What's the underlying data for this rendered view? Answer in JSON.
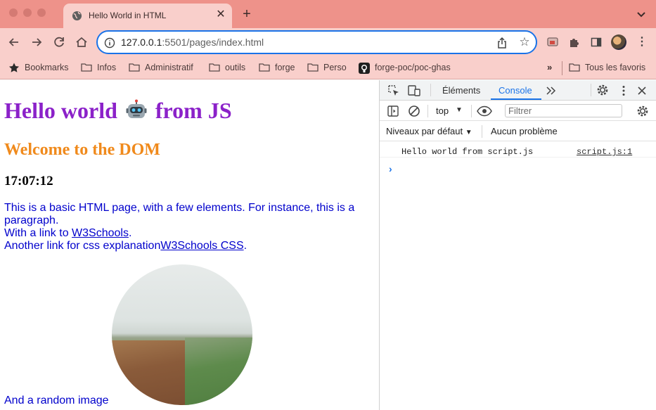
{
  "browser": {
    "tab": {
      "title": "Hello World in HTML",
      "favicon": "globe-icon"
    },
    "address": {
      "host": "127.0.0.1",
      "rest": ":5501/pages/index.html"
    },
    "bookmarks": [
      {
        "label": "Bookmarks",
        "icon": "star-icon"
      },
      {
        "label": "Infos",
        "icon": "folder-icon"
      },
      {
        "label": "Administratif",
        "icon": "folder-icon"
      },
      {
        "label": "outils",
        "icon": "folder-icon"
      },
      {
        "label": "forge",
        "icon": "folder-icon"
      },
      {
        "label": "Perso",
        "icon": "folder-icon"
      },
      {
        "label": "forge-poc/poc-ghas",
        "icon": "github-icon"
      }
    ],
    "bookmarks_overflow": "»",
    "all_bookmarks": "Tous les favoris",
    "colors": {
      "tabstrip": "#ee928a",
      "toolbar": "#f9cfcb",
      "accent": "#1a73e8"
    }
  },
  "page": {
    "heading_before": "Hello world",
    "heading_after": "from JS",
    "heading_icon": "robot-icon",
    "subheading": "Welcome to the DOM",
    "clock": "17:07:12",
    "para_line1": "This is a basic HTML page, with a few elements. For instance, this is a paragraph.",
    "para_line2_prefix": "With a link to ",
    "link1": "W3Schools",
    "para_line2_suffix": ".",
    "para_line3_prefix": "Another link for css explanation",
    "link2": "W3Schools CSS",
    "para_line3_suffix": ".",
    "image_caption": "And a random image",
    "colors": {
      "heading": "#8b21c9",
      "subheading": "#f08a1c",
      "text": "#0000cc"
    }
  },
  "devtools": {
    "tabs": [
      "Éléments",
      "Console"
    ],
    "active_tab": "Console",
    "context": "top",
    "filter_placeholder": "Filtrer",
    "levels": "Niveaux par défaut",
    "issues": "Aucun problème",
    "log": {
      "message": "Hello world from script.js",
      "source": "script.js:1"
    },
    "prompt": "›"
  }
}
